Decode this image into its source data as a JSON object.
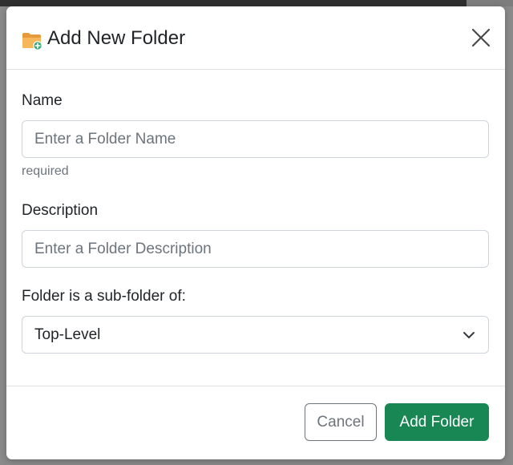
{
  "modal": {
    "title": "Add New Folder",
    "title_icon": "folder-add-icon",
    "close_icon": "close-icon"
  },
  "form": {
    "name": {
      "label": "Name",
      "placeholder": "Enter a Folder Name",
      "value": "",
      "help": "required"
    },
    "description": {
      "label": "Description",
      "placeholder": "Enter a Folder Description",
      "value": ""
    },
    "parent": {
      "label": "Folder is a sub-folder of:",
      "selected": "Top-Level",
      "icon": "chevron-down-icon"
    }
  },
  "footer": {
    "cancel_label": "Cancel",
    "submit_label": "Add Folder"
  },
  "colors": {
    "primary_success": "#198754",
    "folder_orange": "#f0ad4e",
    "badge_green": "#3aa876"
  }
}
